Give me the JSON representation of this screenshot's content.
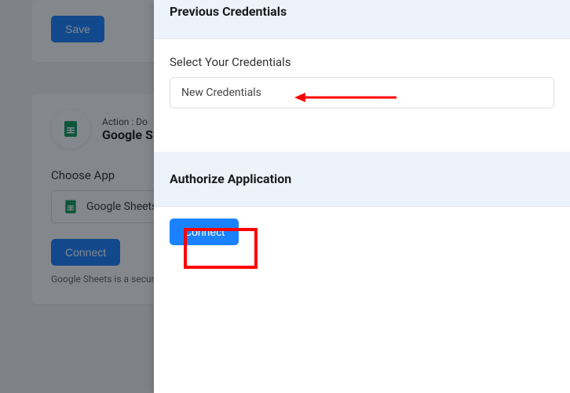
{
  "bg": {
    "save_label": "Save",
    "action_sub": "Action : Do",
    "action_title": "Google S",
    "choose_app_label": "Choose App",
    "choose_app_value": "Google Sheets",
    "connect_label": "Connect",
    "note": "Google Sheets is a secure p"
  },
  "panel": {
    "prev_cred_title": "Previous Credentials",
    "select_cred_label": "Select Your Credentials",
    "select_cred_value": "New Credentials",
    "authorize_title": "Authorize Application",
    "connect_label": "Connect"
  },
  "icons": {
    "google_sheets": "google-sheets-icon"
  },
  "colors": {
    "primary": "#1a82ff",
    "highlight": "#ff0000",
    "panel_header_bg": "#edf3fa"
  }
}
